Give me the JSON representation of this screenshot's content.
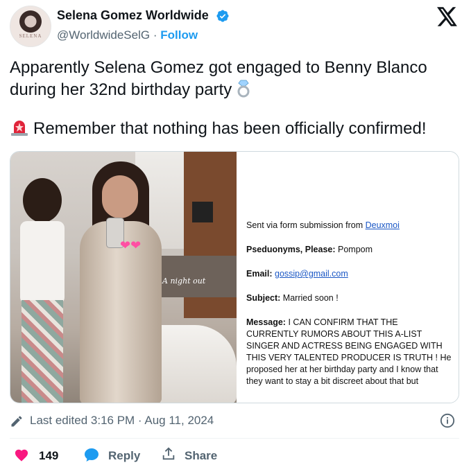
{
  "header": {
    "display_name": "Selena Gomez Worldwide",
    "handle": "@WorldwideSelG",
    "separator": "·",
    "follow_label": "Follow",
    "avatar_text": "SELENA",
    "accent_color": "#1d9bf0"
  },
  "tweet": {
    "line1": "Apparently Selena Gomez got engaged to Benny Blanco",
    "line2": "during her 32nd birthday party",
    "line3": "Remember that nothing has been officially confirmed!",
    "emoji_ring": "ring-icon",
    "emoji_siren": "rotating-light-icon"
  },
  "media": {
    "photo_caption": "A night out",
    "email": {
      "sent_via_label": "Sent via form submission from",
      "sent_via_link": "Deuxmoi",
      "pseudonyms_label": "Pseduonyms, Please:",
      "pseudonyms_value": "Pompom",
      "email_label": "Email:",
      "email_value": "gossip@gmail.com",
      "subject_label": "Subject:",
      "subject_value": "Married soon !",
      "message_label": "Message:",
      "message_value": "I CAN CONFIRM THAT THE CURRENTLY RUMORS ABOUT THIS A-LIST SINGER AND ACTRESS BEING ENGAGED WITH THIS VERY TALENTED PRODUCER IS TRUTH ! He proposed her at her birthday party and I know that they want to stay a bit discreet about that but"
    }
  },
  "meta": {
    "edited_text": "Last edited 3:16 PM · Aug 11, 2024"
  },
  "actions": {
    "likes": "149",
    "reply_label": "Reply",
    "share_label": "Share",
    "like_color": "#f91880"
  }
}
